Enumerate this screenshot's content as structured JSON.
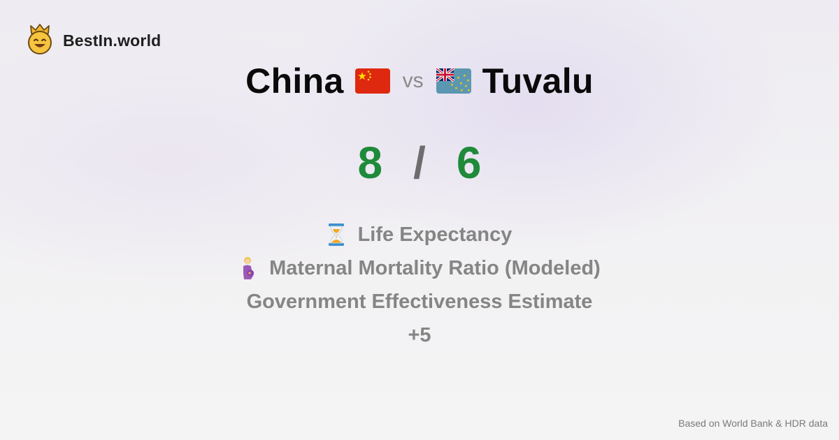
{
  "brand": {
    "name": "BestIn.world",
    "logo_icon": "crown-smiley-icon"
  },
  "comparison": {
    "country_a": {
      "name": "China",
      "flag_icon": "china-flag-icon",
      "score": "8"
    },
    "vs_label": "vs",
    "country_b": {
      "name": "Tuvalu",
      "flag_icon": "tuvalu-flag-icon",
      "score": "6"
    },
    "separator": "/"
  },
  "metrics": [
    {
      "label": "Life Expectancy",
      "icon": "hourglass-icon"
    },
    {
      "label": "Maternal Mortality Ratio (Modeled)",
      "icon": "pregnant-woman-icon"
    },
    {
      "label": "Government Effectiveness Estimate",
      "icon": ""
    }
  ],
  "more_label": "+5",
  "footer": {
    "source_text": "Based on World Bank & HDR data"
  },
  "colors": {
    "score_green": "#1f8a3a",
    "metric_gray": "#858585",
    "title_black": "#0a0a0a",
    "china_red": "#de2910",
    "china_yellow": "#ffde00",
    "tuvalu_blue": "#5b97b1"
  }
}
